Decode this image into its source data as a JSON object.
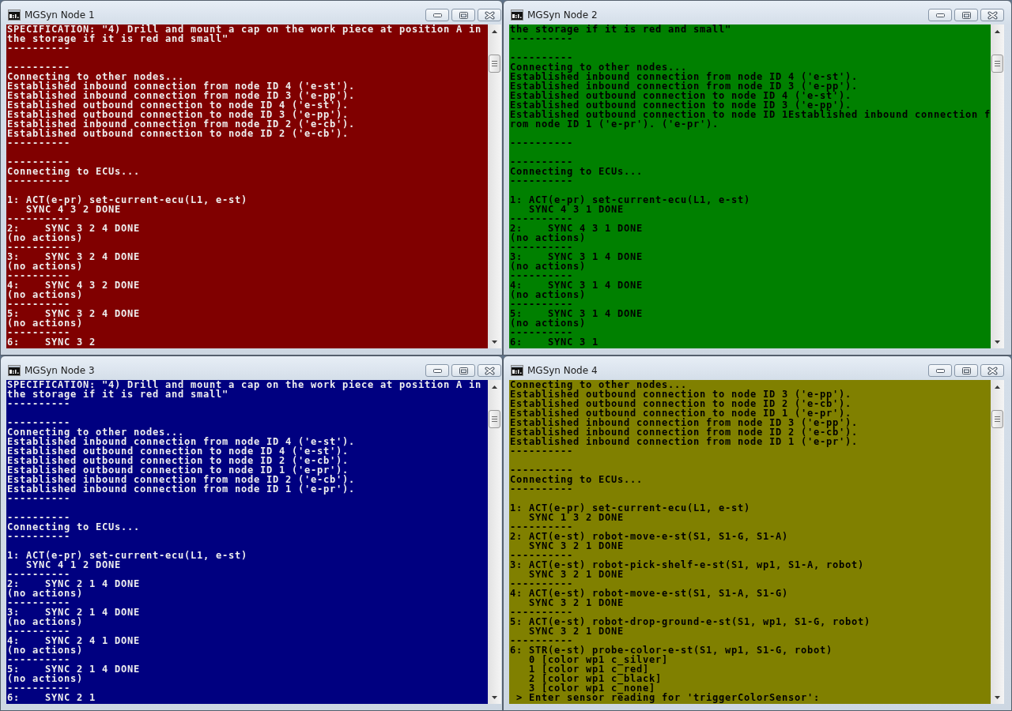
{
  "windows": [
    {
      "title": "MGSyn Node 1",
      "color": "#800000",
      "blocks": [
        [
          "SPECIFICATION: \"4) Drill and mount a cap on the work piece at position A in",
          "the storage if it is red and small\"",
          "----------"
        ],
        [
          "----------",
          "Connecting to other nodes...",
          "Established inbound connection from node ID 4 ('e-st').",
          "Established inbound connection from node ID 3 ('e-pp').",
          "Established outbound connection to node ID 4 ('e-st').",
          "Established outbound connection to node ID 3 ('e-pp').",
          "Established inbound connection from node ID 2 ('e-cb').",
          "Established outbound connection to node ID 2 ('e-cb').",
          "----------"
        ],
        [
          "----------",
          "Connecting to ECUs...",
          "----------"
        ],
        [
          "1: ACT(e-pr) set-current-ecu(L1, e-st)",
          "   SYNC 4 3 2 DONE",
          "----------",
          "2:    SYNC 3 2 4 DONE",
          "(no actions)",
          "----------",
          "3:    SYNC 3 2 4 DONE",
          "(no actions)",
          "----------",
          "4:    SYNC 4 3 2 DONE",
          "(no actions)",
          "----------",
          "5:    SYNC 3 2 4 DONE",
          "(no actions)",
          "----------",
          "6:    SYNC 3 2"
        ]
      ]
    },
    {
      "title": "MGSyn Node 2",
      "color": "#008000",
      "blocks": [
        [
          "the storage if it is red and small\"",
          "----------"
        ],
        [
          "----------",
          "Connecting to other nodes...",
          "Established inbound connection from node ID 4 ('e-st').",
          "Established inbound connection from node ID 3 ('e-pp').",
          "Established outbound connection to node ID 4 ('e-st').",
          "Established outbound connection to node ID 3 ('e-pp').",
          "Established outbound connection to node ID 1Established inbound connection f",
          "rom node ID 1 ('e-pr'). ('e-pr')."
        ],
        [
          "----------"
        ],
        [
          "----------",
          "Connecting to ECUs...",
          "----------"
        ],
        [
          "1: ACT(e-pr) set-current-ecu(L1, e-st)",
          "   SYNC 4 3 1 DONE",
          "----------",
          "2:    SYNC 4 3 1 DONE",
          "(no actions)",
          "----------",
          "3:    SYNC 3 1 4 DONE",
          "(no actions)",
          "----------",
          "4:    SYNC 3 1 4 DONE",
          "(no actions)",
          "----------",
          "5:    SYNC 3 1 4 DONE",
          "(no actions)",
          "----------",
          "6:    SYNC 3 1"
        ]
      ]
    },
    {
      "title": "MGSyn Node 3",
      "color": "#000080",
      "blocks": [
        [
          "SPECIFICATION: \"4) Drill and mount a cap on the work piece at position A in",
          "the storage if it is red and small\"",
          "----------"
        ],
        [
          "----------",
          "Connecting to other nodes...",
          "Established inbound connection from node ID 4 ('e-st').",
          "Established outbound connection to node ID 4 ('e-st').",
          "Established outbound connection to node ID 2 ('e-cb').",
          "Established outbound connection to node ID 1 ('e-pr').",
          "Established inbound connection from node ID 2 ('e-cb').",
          "Established inbound connection from node ID 1 ('e-pr').",
          "----------"
        ],
        [
          "----------",
          "Connecting to ECUs...",
          "----------"
        ],
        [
          "1: ACT(e-pr) set-current-ecu(L1, e-st)",
          "   SYNC 4 1 2 DONE",
          "----------",
          "2:    SYNC 2 1 4 DONE",
          "(no actions)",
          "----------",
          "3:    SYNC 2 1 4 DONE",
          "(no actions)",
          "----------",
          "4:    SYNC 2 4 1 DONE",
          "(no actions)",
          "----------",
          "5:    SYNC 2 1 4 DONE",
          "(no actions)",
          "----------",
          "6:    SYNC 2 1"
        ]
      ]
    },
    {
      "title": "MGSyn Node 4",
      "color": "#808000",
      "blocks": [
        [
          "Connecting to other nodes...",
          "Established outbound connection to node ID 3 ('e-pp').",
          "Established outbound connection to node ID 2 ('e-cb').",
          "Established outbound connection to node ID 1 ('e-pr').",
          "Established inbound connection from node ID 3 ('e-pp').",
          "Established inbound connection from node ID 2 ('e-cb').",
          "Established inbound connection from node ID 1 ('e-pr').",
          "----------"
        ],
        [
          "----------",
          "Connecting to ECUs...",
          "----------"
        ],
        [
          "1: ACT(e-pr) set-current-ecu(L1, e-st)",
          "   SYNC 1 3 2 DONE",
          "----------",
          "2: ACT(e-st) robot-move-e-st(S1, S1-G, S1-A)",
          "   SYNC 3 2 1 DONE",
          "----------",
          "3: ACT(e-st) robot-pick-shelf-e-st(S1, wp1, S1-A, robot)",
          "   SYNC 3 2 1 DONE",
          "----------",
          "4: ACT(e-st) robot-move-e-st(S1, S1-A, S1-G)",
          "   SYNC 3 2 1 DONE",
          "----------",
          "5: ACT(e-st) robot-drop-ground-e-st(S1, wp1, S1-G, robot)",
          "   SYNC 3 2 1 DONE",
          "----------",
          "6: STR(e-st) probe-color-e-st(S1, wp1, S1-G, robot)",
          "   0 [color wp1 c_silver]",
          "   1 [color wp1 c_red]",
          "   2 [color wp1 c_black]",
          "   3 [color wp1 c_none]",
          " > Enter sensor reading for 'triggerColorSensor':"
        ]
      ]
    }
  ]
}
